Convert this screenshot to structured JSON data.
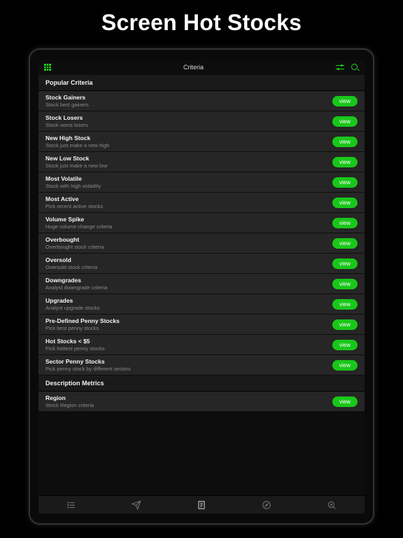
{
  "headline": "Screen Hot Stocks",
  "topbar": {
    "title": "Criteria"
  },
  "sections": [
    {
      "header": "Popular Criteria",
      "items": [
        {
          "title": "Stock Gainers",
          "desc": "Stock best gainers",
          "btn": "view"
        },
        {
          "title": "Stock Losers",
          "desc": "Stock worst losers",
          "btn": "view"
        },
        {
          "title": "New High Stock",
          "desc": "Stock just make a new high",
          "btn": "view"
        },
        {
          "title": "New Low Stock",
          "desc": "Stock just make a new low",
          "btn": "view"
        },
        {
          "title": "Most Volatile",
          "desc": "Stock with high volatility",
          "btn": "view"
        },
        {
          "title": "Most Active",
          "desc": "Pick recent active stocks",
          "btn": "view"
        },
        {
          "title": "Volume Spike",
          "desc": "Huge volume change criteria",
          "btn": "view"
        },
        {
          "title": "Overbought",
          "desc": "Overbought stock criteria",
          "btn": "view"
        },
        {
          "title": "Oversold",
          "desc": "Oversold stock criteria",
          "btn": "view"
        },
        {
          "title": "Downgrades",
          "desc": "Analyst downgrade criteria",
          "btn": "view"
        },
        {
          "title": "Upgrades",
          "desc": "Analyst upgrade stocks",
          "btn": "view"
        },
        {
          "title": "Pre-Defined Penny Stocks",
          "desc": "Pick best penny stocks",
          "btn": "view"
        },
        {
          "title": "Hot Stocks < $5",
          "desc": "Pick hottest penny stocks",
          "btn": "view"
        },
        {
          "title": "Sector Penny Stocks",
          "desc": "Pick penny stock by different sectors",
          "btn": "view"
        }
      ]
    },
    {
      "header": "Description Metrics",
      "items": [
        {
          "title": "Region",
          "desc": "Stock Region criteria",
          "btn": "view"
        }
      ]
    }
  ]
}
